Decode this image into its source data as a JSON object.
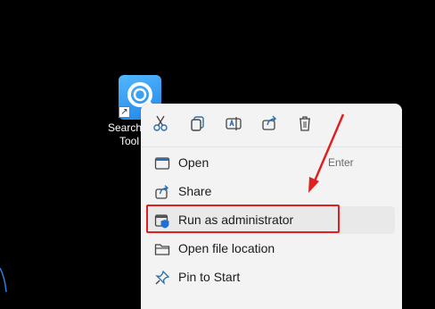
{
  "desktop": {
    "app_icon": {
      "icon": "search-tool-icon",
      "label_line1": "Search",
      "label_line2": "Tool"
    }
  },
  "context_menu": {
    "quick_actions": [
      {
        "name": "cut",
        "icon": "scissors-icon"
      },
      {
        "name": "copy",
        "icon": "copy-icon"
      },
      {
        "name": "rename",
        "icon": "rename-icon"
      },
      {
        "name": "share",
        "icon": "share-icon"
      },
      {
        "name": "delete",
        "icon": "trash-icon"
      }
    ],
    "items": [
      {
        "label": "Open",
        "shortcut": "Enter",
        "icon": "open-window-icon"
      },
      {
        "label": "Share",
        "icon": "share-icon"
      },
      {
        "label": "Run as administrator",
        "icon": "shield-icon"
      },
      {
        "label": "Open file location",
        "icon": "folder-icon"
      },
      {
        "label": "Pin to Start",
        "icon": "pin-icon"
      }
    ]
  },
  "annotation": {
    "color": "#e02020",
    "target": "Run as administrator"
  },
  "colors": {
    "menu_bg": "#f3f3f3",
    "hover_bg": "#e9e9e9",
    "accent": "#1f86e6"
  }
}
